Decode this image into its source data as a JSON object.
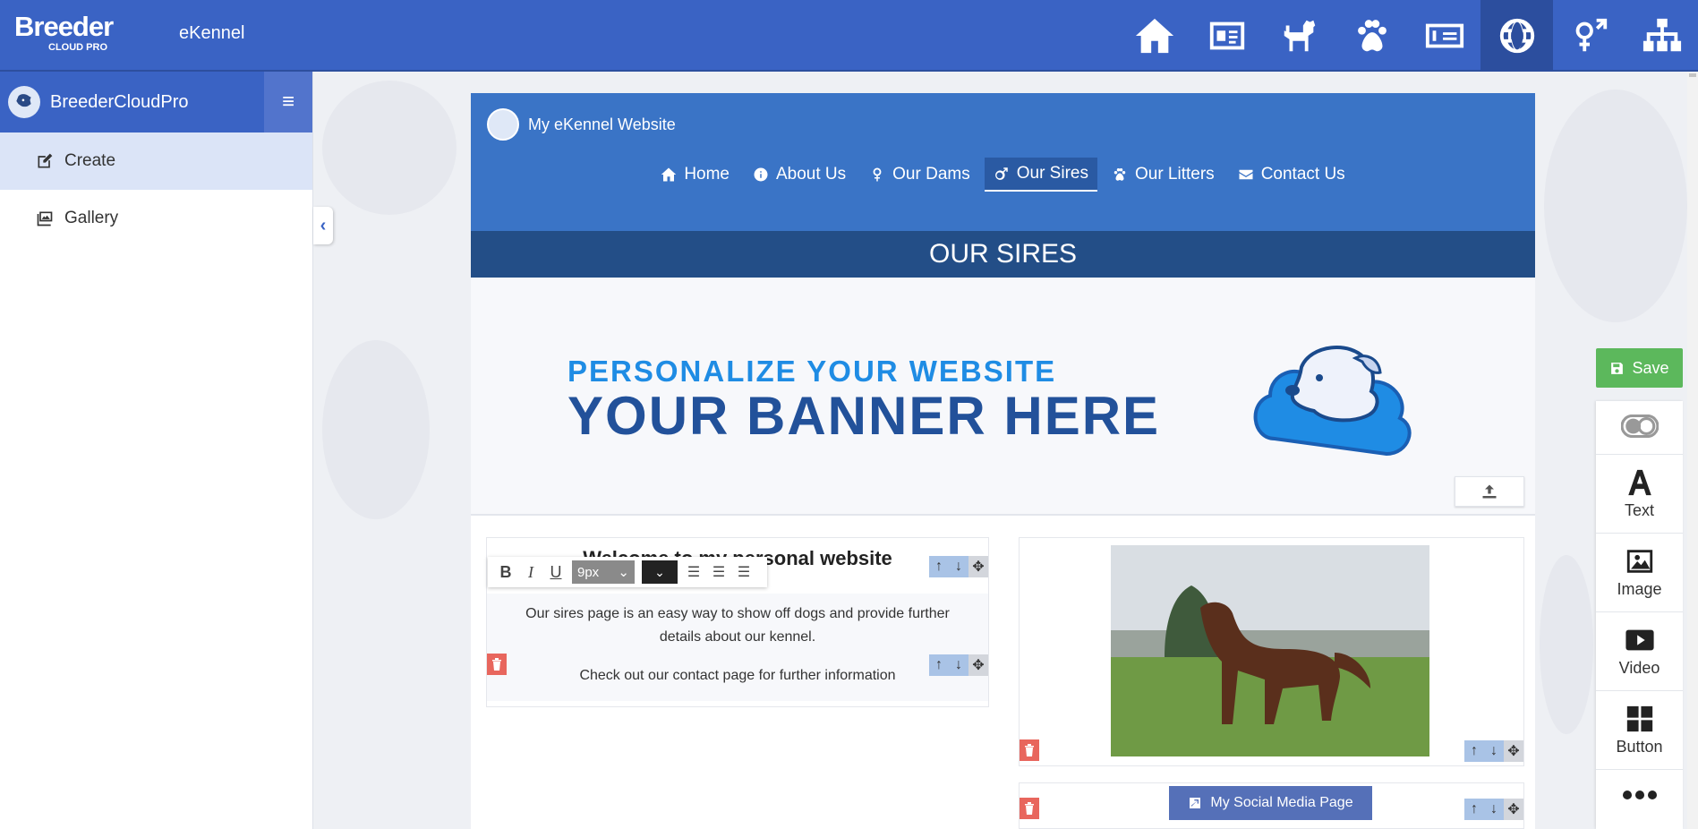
{
  "app": {
    "brand_main": "Breeder",
    "brand_sub": "CLOUD PRO",
    "name": "eKennel"
  },
  "topnav": [
    {
      "icon": "home-icon"
    },
    {
      "icon": "id-card-icon"
    },
    {
      "icon": "dog-icon"
    },
    {
      "icon": "paw-icon"
    },
    {
      "icon": "invoice-icon"
    },
    {
      "icon": "globe-icon",
      "active": true
    },
    {
      "icon": "gender-icon"
    },
    {
      "icon": "sitemap-icon"
    }
  ],
  "sidebar": {
    "title": "BreederCloudPro",
    "items": [
      {
        "label": "Create",
        "icon": "edit-icon",
        "active": true
      },
      {
        "label": "Gallery",
        "icon": "gallery-icon"
      }
    ]
  },
  "site": {
    "name": "My eKennel Website",
    "nav": [
      {
        "label": "Home",
        "icon": "home-icon"
      },
      {
        "label": "About Us",
        "icon": "info-icon"
      },
      {
        "label": "Our Dams",
        "icon": "female-icon"
      },
      {
        "label": "Our Sires",
        "icon": "male-icon",
        "active": true
      },
      {
        "label": "Our Litters",
        "icon": "paw-icon"
      },
      {
        "label": "Contact Us",
        "icon": "envelope-icon"
      }
    ],
    "page_title": "OUR SIRES",
    "banner": {
      "line1": "PERSONALIZE YOUR WEBSITE",
      "line2": "YOUR BANNER HERE"
    },
    "text_block": {
      "heading": "Welcome to my personal website",
      "para1": "Our sires page is an easy way to show off dogs and provide further details about our kennel.",
      "para2": "Check out our contact page for further information"
    },
    "toolbar": {
      "bold": "B",
      "italic": "I",
      "underline": "U",
      "font_size": "9px"
    },
    "social_button": "My Social Media Page"
  },
  "right_panel": {
    "save": "Save",
    "tools": [
      {
        "label": "",
        "icon": "toggle-icon"
      },
      {
        "label": "Text",
        "icon": "text-icon"
      },
      {
        "label": "Image",
        "icon": "image-icon"
      },
      {
        "label": "Video",
        "icon": "video-icon"
      },
      {
        "label": "Button",
        "icon": "button-grid-icon"
      },
      {
        "label": "",
        "icon": "more-icon"
      }
    ]
  },
  "colors": {
    "primary": "#3a63c4",
    "site_header": "#3a74c6",
    "title_bar": "#234e87",
    "save": "#5cb85c",
    "delete": "#e8665d"
  }
}
